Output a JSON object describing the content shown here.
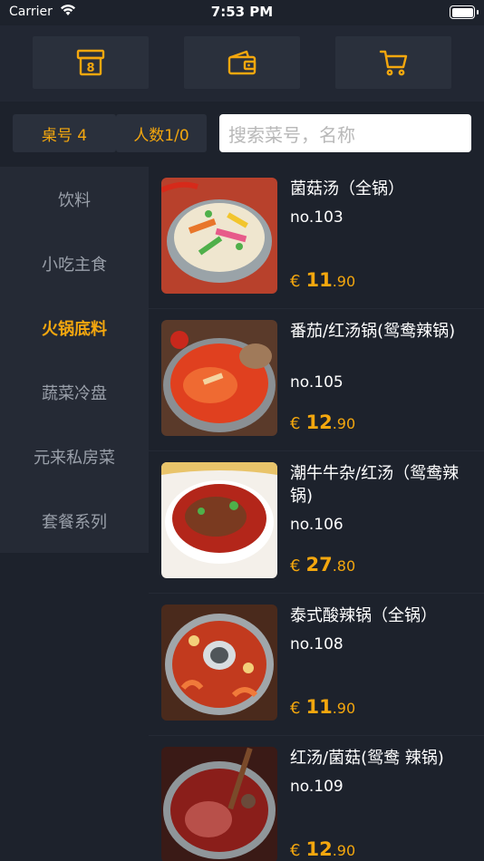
{
  "status_bar": {
    "carrier": "Carrier",
    "time": "7:53 PM"
  },
  "toolbar": {
    "buttons": [
      {
        "icon": "order-box-icon"
      },
      {
        "icon": "wallet-icon"
      },
      {
        "icon": "cart-icon"
      }
    ],
    "accent_color": "#f4a70e"
  },
  "filters": {
    "table_label": "桌号 4",
    "people_label": "人数1/0",
    "search_placeholder": "搜索菜号，名称"
  },
  "categories": [
    {
      "label": "饮料",
      "active": false
    },
    {
      "label": "小吃主食",
      "active": false
    },
    {
      "label": "火锅底料",
      "active": true
    },
    {
      "label": "蔬菜冷盘",
      "active": false
    },
    {
      "label": "元来私房菜",
      "active": false
    },
    {
      "label": "套餐系列",
      "active": false
    }
  ],
  "dishes": [
    {
      "name": "菌菇汤（全锅）",
      "code": "no.103",
      "currency": "€",
      "price_int": "11",
      "price_dec": ".90"
    },
    {
      "name": "番茄/红汤锅(鸳鸯辣锅)",
      "code": "no.105",
      "currency": "€",
      "price_int": "12",
      "price_dec": ".90"
    },
    {
      "name": "潮牛牛杂/红汤（鸳鸯辣锅)",
      "code": "no.106",
      "currency": "€",
      "price_int": "27",
      "price_dec": ".80"
    },
    {
      "name": "泰式酸辣锅（全锅）",
      "code": "no.108",
      "currency": "€",
      "price_int": "11",
      "price_dec": ".90"
    },
    {
      "name": "红汤/菌菇(鸳鸯 辣锅)",
      "code": "no.109",
      "currency": "€",
      "price_int": "12",
      "price_dec": ".90"
    }
  ]
}
